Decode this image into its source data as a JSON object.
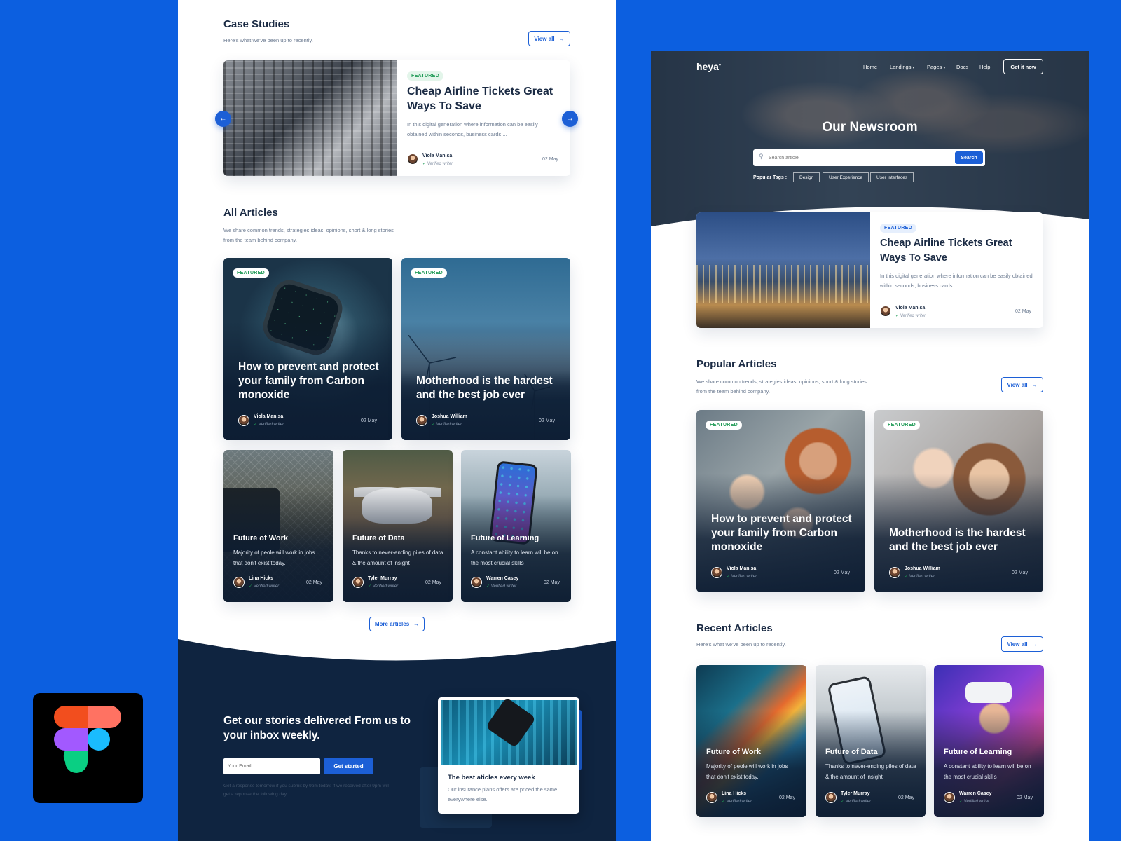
{
  "left": {
    "case": {
      "title": "Case Studies",
      "subtitle": "Here's what we've been up to recently.",
      "view_all": "View all",
      "badge": "FEATURED",
      "card_title": "Cheap Airline Tickets Great Ways To Save",
      "card_desc": "In this digital generation where information can be easily obtained within seconds, business cards ...",
      "author": "Viola Manisa",
      "verified": "Verified writer",
      "date": "02 May"
    },
    "all": {
      "title": "All Articles",
      "subtitle": "We share common trends, strategies ideas, opinions, short & long stories from the team behind company.",
      "big": [
        {
          "badge": "FEATURED",
          "title": "How to prevent and protect your family from Carbon monoxide",
          "author": "Viola Manisa",
          "verified": "Verified writer",
          "date": "02 May"
        },
        {
          "badge": "FEATURED",
          "title": "Motherhood is the hardest and the best job ever",
          "author": "Joshua William",
          "verified": "Verified writer",
          "date": "02 May"
        }
      ],
      "small": [
        {
          "title": "Future of Work",
          "desc": "Majority of peole will work in jobs that don't exist today.",
          "author": "Lina Hicks",
          "verified": "Verified writer",
          "date": "02 May"
        },
        {
          "title": "Future of Data",
          "desc": "Thanks to never-ending piles of data & the amount of insight",
          "author": "Tyler Murray",
          "verified": "Verified writer",
          "date": "02 May"
        },
        {
          "title": "Future of Learning",
          "desc": "A constant ability to learn will be on the most crucial skills",
          "author": "Warren Casey",
          "verified": "Verified writer",
          "date": "02 May"
        }
      ],
      "more": "More articles"
    },
    "newsletter": {
      "title": "Get our stories delivered From us to your inbox weekly.",
      "email_placeholder": "Your Email",
      "cta": "Get started",
      "note": "Get a response tomorrow if you submit by 9pm today. If we received after 9pm will get a reponse the following day.",
      "card_title": "The best aticles every week",
      "card_desc": "Our insurance plans offers are priced the same everywhere else."
    }
  },
  "right": {
    "nav": {
      "logo": "heya",
      "items": [
        "Home",
        "Landings",
        "Pages",
        "Docs",
        "Help"
      ],
      "cta": "Get it now"
    },
    "hero": {
      "title": "Our Newsroom",
      "search_placeholder": "Search article",
      "search_button": "Search",
      "tags_label": "Popular Tags :",
      "tags": [
        "Design",
        "User Experience",
        "User Interfaces"
      ]
    },
    "featured": {
      "badge": "FEATURED",
      "title": "Cheap Airline Tickets Great Ways To Save",
      "desc": "In this digital generation where information can be easily obtained within seconds, business cards ...",
      "author": "Viola Manisa",
      "verified": "Verified writer",
      "date": "02 May"
    },
    "popular": {
      "title": "Popular Articles",
      "subtitle": "We share common trends, strategies ideas, opinions, short & long stories from the team behind company.",
      "view_all": "View all",
      "cards": [
        {
          "badge": "FEATURED",
          "title": "How to prevent and protect your family from Carbon monoxide",
          "author": "Viola Manisa",
          "verified": "Verified writer",
          "date": "02 May"
        },
        {
          "badge": "FEATURED",
          "title": "Motherhood is the hardest and the best job ever",
          "author": "Joshua William",
          "verified": "Verified writer",
          "date": "02 May"
        }
      ]
    },
    "recent": {
      "title": "Recent Articles",
      "subtitle": "Here's what we've been up to recently.",
      "view_all": "View all",
      "cards": [
        {
          "title": "Future of Work",
          "desc": "Majority of peole will work in jobs that don't exist today.",
          "author": "Lina Hicks",
          "verified": "Verified writer",
          "date": "02 May"
        },
        {
          "title": "Future of Data",
          "desc": "Thanks to never-ending piles of data & the amount of insight",
          "author": "Tyler Murray",
          "verified": "Verified writer",
          "date": "02 May"
        },
        {
          "title": "Future of Learning",
          "desc": "A constant ability to learn will be on the most crucial skills",
          "author": "Warren Casey",
          "verified": "Verified writer",
          "date": "02 May"
        }
      ]
    }
  },
  "colors": {
    "background": "#0c5fe0",
    "primary": "#1c5fd6",
    "dark": "#0f2440",
    "featured_green": "#1f9a55"
  },
  "icons": [
    "arrow-right-icon",
    "arrow-left-icon",
    "search-icon",
    "chevron-down-icon",
    "verified-check-icon",
    "figma-logo-icon"
  ]
}
